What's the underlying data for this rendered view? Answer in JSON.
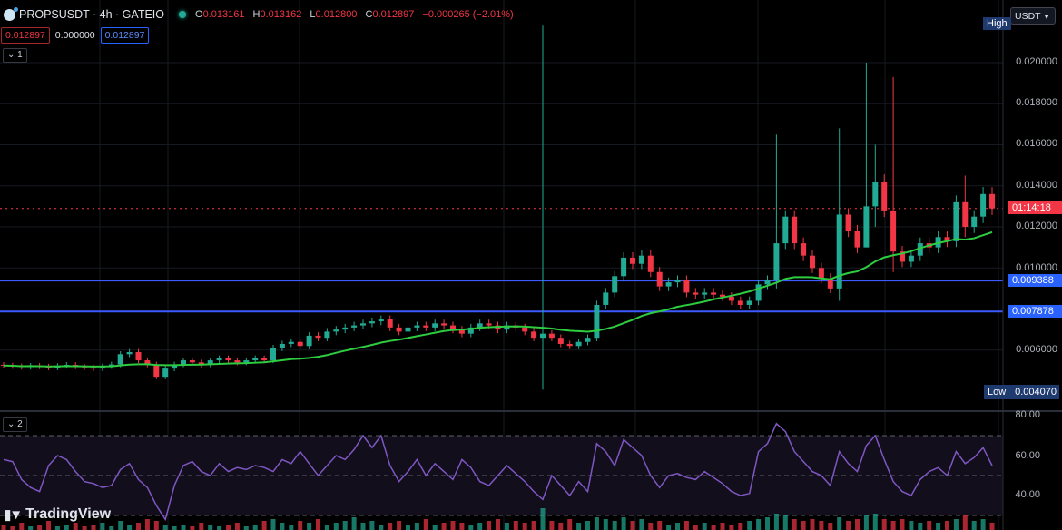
{
  "header": {
    "symbol": "PROPSUSDT · 4h · GATEIO",
    "open_label": "O",
    "open": "0.013161",
    "high_label": "H",
    "high": "0.013162",
    "low_label": "L",
    "low": "0.012800",
    "close_label": "C",
    "close": "0.012897",
    "change": "−0.000265 (−2.01%)"
  },
  "quote": {
    "bid": "0.012897",
    "spread": "0.000000",
    "ask": "0.012897"
  },
  "panes": {
    "main_toggle": "⌄ 1",
    "rsi_toggle": "⌄ 2"
  },
  "currency_select": "USDT",
  "price_axis": {
    "high_tag": "High",
    "low_tag": "Low",
    "low_value": "0.004070",
    "countdown": "01:14:18",
    "levels": [
      "0.009388",
      "0.007878"
    ],
    "ticks": [
      "0.020000",
      "0.018000",
      "0.016000",
      "0.014000",
      "0.012000",
      "0.010000",
      "0.006000"
    ]
  },
  "rsi_axis": {
    "ticks": [
      "80.00",
      "60.00",
      "40.00"
    ]
  },
  "branding": "TradingView",
  "colors": {
    "up": "#22ab94",
    "down": "#f23645",
    "ma": "#2ecc40",
    "rsi": "#7e57c2",
    "level": "#3d5afe"
  },
  "chart_data": {
    "type": "candlestick",
    "title": "PROPSUSDT · 4h · GATEIO",
    "ylim": [
      0.0037,
      0.0222
    ],
    "yticks": [
      0.02,
      0.018,
      0.016,
      0.014,
      0.012,
      0.01,
      0.006
    ],
    "horizontal_levels": [
      0.009388,
      0.007878
    ],
    "last_price": 0.012897,
    "period_high_low": {
      "low": 0.00407
    },
    "ma_period": 20,
    "closes": [
      0.00525,
      0.00522,
      0.00518,
      0.00524,
      0.0052,
      0.00515,
      0.00523,
      0.00528,
      0.0052,
      0.00516,
      0.0051,
      0.00522,
      0.0053,
      0.0058,
      0.0059,
      0.0055,
      0.0053,
      0.0047,
      0.0051,
      0.0053,
      0.0055,
      0.0054,
      0.0053,
      0.0055,
      0.0056,
      0.0055,
      0.0054,
      0.0055,
      0.0056,
      0.0055,
      0.0061,
      0.0063,
      0.0064,
      0.0062,
      0.0067,
      0.0066,
      0.0069,
      0.007,
      0.0071,
      0.0072,
      0.0073,
      0.0074,
      0.0075,
      0.0071,
      0.0069,
      0.0071,
      0.0072,
      0.0071,
      0.0073,
      0.0072,
      0.007,
      0.0068,
      0.0071,
      0.0073,
      0.0072,
      0.007,
      0.0072,
      0.0071,
      0.0069,
      0.0066,
      0.0068,
      0.0066,
      0.0063,
      0.0062,
      0.0064,
      0.0066,
      0.0082,
      0.0088,
      0.0096,
      0.0105,
      0.0102,
      0.0106,
      0.0098,
      0.0091,
      0.0093,
      0.0094,
      0.0088,
      0.0087,
      0.0088,
      0.0087,
      0.0086,
      0.0084,
      0.0082,
      0.0084,
      0.0092,
      0.0094,
      0.0112,
      0.0125,
      0.0112,
      0.0106,
      0.01,
      0.0095,
      0.009,
      0.0126,
      0.0118,
      0.011,
      0.013,
      0.0142,
      0.0128,
      0.0108,
      0.0103,
      0.0106,
      0.0112,
      0.011,
      0.0115,
      0.0113,
      0.0132,
      0.012,
      0.0125,
      0.0136,
      0.012897
    ],
    "first_open": 0.00528,
    "wick_spikes": [
      {
        "index": 60,
        "high": 0.0218,
        "low": 0.00407
      },
      {
        "index": 86,
        "high": 0.0165,
        "low": 0.009
      },
      {
        "index": 93,
        "high": 0.0168,
        "low": 0.0084
      },
      {
        "index": 96,
        "high": 0.02,
        "low": 0.011
      },
      {
        "index": 99,
        "high": 0.0193,
        "low": 0.0098
      },
      {
        "index": 97,
        "high": 0.016,
        "low": 0.012
      },
      {
        "index": 107,
        "high": 0.0145,
        "low": 0.0115
      }
    ],
    "rsi": {
      "ylim": [
        25,
        85
      ],
      "overbought": 70,
      "mid": 50,
      "oversold": 30,
      "values": [
        58,
        57,
        48,
        44,
        42,
        55,
        60,
        58,
        52,
        47,
        46,
        44,
        45,
        53,
        56,
        48,
        44,
        35,
        28,
        45,
        55,
        57,
        52,
        50,
        56,
        52,
        54,
        53,
        55,
        54,
        52,
        58,
        56,
        62,
        56,
        50,
        55,
        60,
        58,
        63,
        70,
        64,
        70,
        55,
        47,
        52,
        58,
        50,
        56,
        52,
        48,
        58,
        54,
        47,
        45,
        50,
        55,
        51,
        47,
        42,
        38,
        50,
        45,
        40,
        47,
        42,
        66,
        62,
        55,
        68,
        64,
        60,
        50,
        44,
        50,
        51,
        49,
        48,
        52,
        49,
        46,
        42,
        40,
        41,
        62,
        66,
        76,
        72,
        62,
        57,
        52,
        50,
        45,
        62,
        56,
        52,
        65,
        70,
        58,
        47,
        42,
        40,
        48,
        52,
        54,
        50,
        62,
        56,
        59,
        64,
        55
      ]
    },
    "volume": [
      3,
      2,
      4,
      2,
      3,
      5,
      2,
      3,
      4,
      2,
      3,
      4,
      2,
      5,
      3,
      4,
      6,
      5,
      3,
      2,
      3,
      2,
      4,
      3,
      2,
      3,
      4,
      2,
      3,
      5,
      6,
      4,
      3,
      5,
      4,
      6,
      3,
      4,
      5,
      7,
      4,
      5,
      3,
      4,
      5,
      3,
      4,
      6,
      3,
      4,
      5,
      4,
      3,
      4,
      5,
      6,
      4,
      5,
      4,
      5,
      12,
      5,
      4,
      6,
      4,
      5,
      7,
      6,
      5,
      7,
      5,
      6,
      4,
      5,
      3,
      4,
      5,
      3,
      4,
      3,
      4,
      3,
      4,
      5,
      6,
      7,
      9,
      8,
      6,
      5,
      6,
      5,
      4,
      7,
      5,
      6,
      8,
      9,
      6,
      5,
      6,
      5,
      4,
      5,
      4,
      5,
      6,
      8,
      5,
      6,
      4
    ]
  }
}
